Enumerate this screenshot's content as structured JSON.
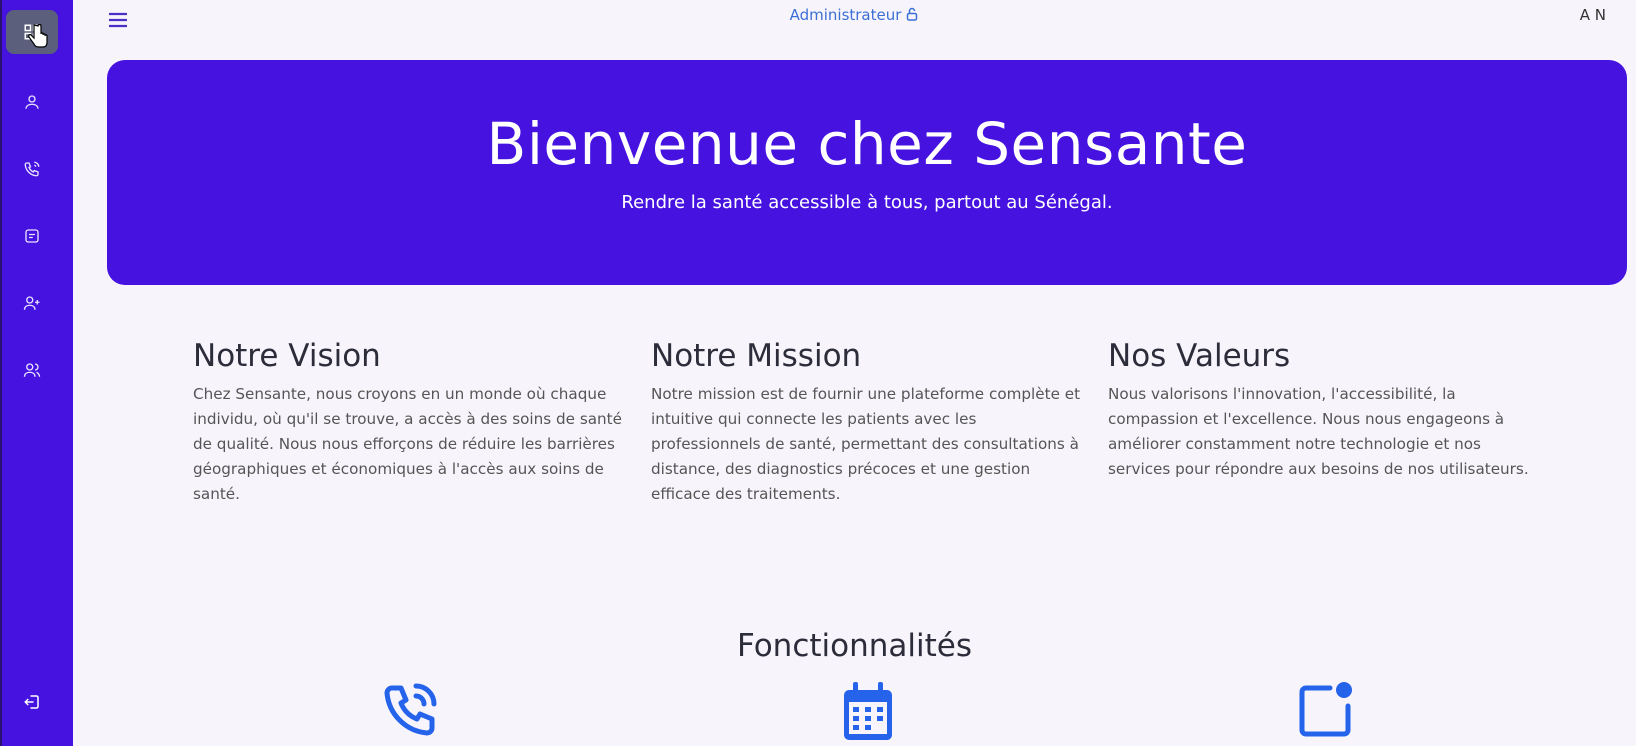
{
  "sidebar": {
    "items": [
      {
        "icon": "grid-icon",
        "active": true
      },
      {
        "icon": "user-icon"
      },
      {
        "icon": "phone-call-icon"
      },
      {
        "icon": "note-icon"
      },
      {
        "icon": "user-plus-icon"
      },
      {
        "icon": "users-icon"
      }
    ],
    "logout_icon": "logout-icon"
  },
  "topbar": {
    "role": "Administrateur",
    "initials": "A N"
  },
  "hero": {
    "title": "Bienvenue chez Sensante",
    "subtitle": "Rendre la santé accessible à tous, partout au Sénégal."
  },
  "sections": [
    {
      "title": "Notre Vision",
      "text": "Chez Sensante, nous croyons en un monde où chaque individu, où qu'il se trouve, a accès à des soins de santé de qualité. Nous nous efforçons de réduire les barrières géographiques et économiques à l'accès aux soins de santé."
    },
    {
      "title": "Notre Mission",
      "text": "Notre mission est de fournir une plateforme complète et intuitive qui connecte les patients avec les professionnels de santé, permettant des consultations à distance, des diagnostics précoces et une gestion efficace des traitements."
    },
    {
      "title": "Nos Valeurs",
      "text": "Nous valorisons l'innovation, l'accessibilité, la compassion et l'excellence. Nous nous engageons à améliorer constamment notre technologie et nos services pour répondre aux besoins de nos utilisateurs."
    }
  ],
  "features": {
    "title": "Fonctionnalités",
    "icons": [
      "phone-call-icon",
      "calendar-icon",
      "notification-icon"
    ]
  },
  "colors": {
    "brand": "#4612e0",
    "feature_icon": "#2563eb",
    "role_text": "#3b6fd6"
  }
}
